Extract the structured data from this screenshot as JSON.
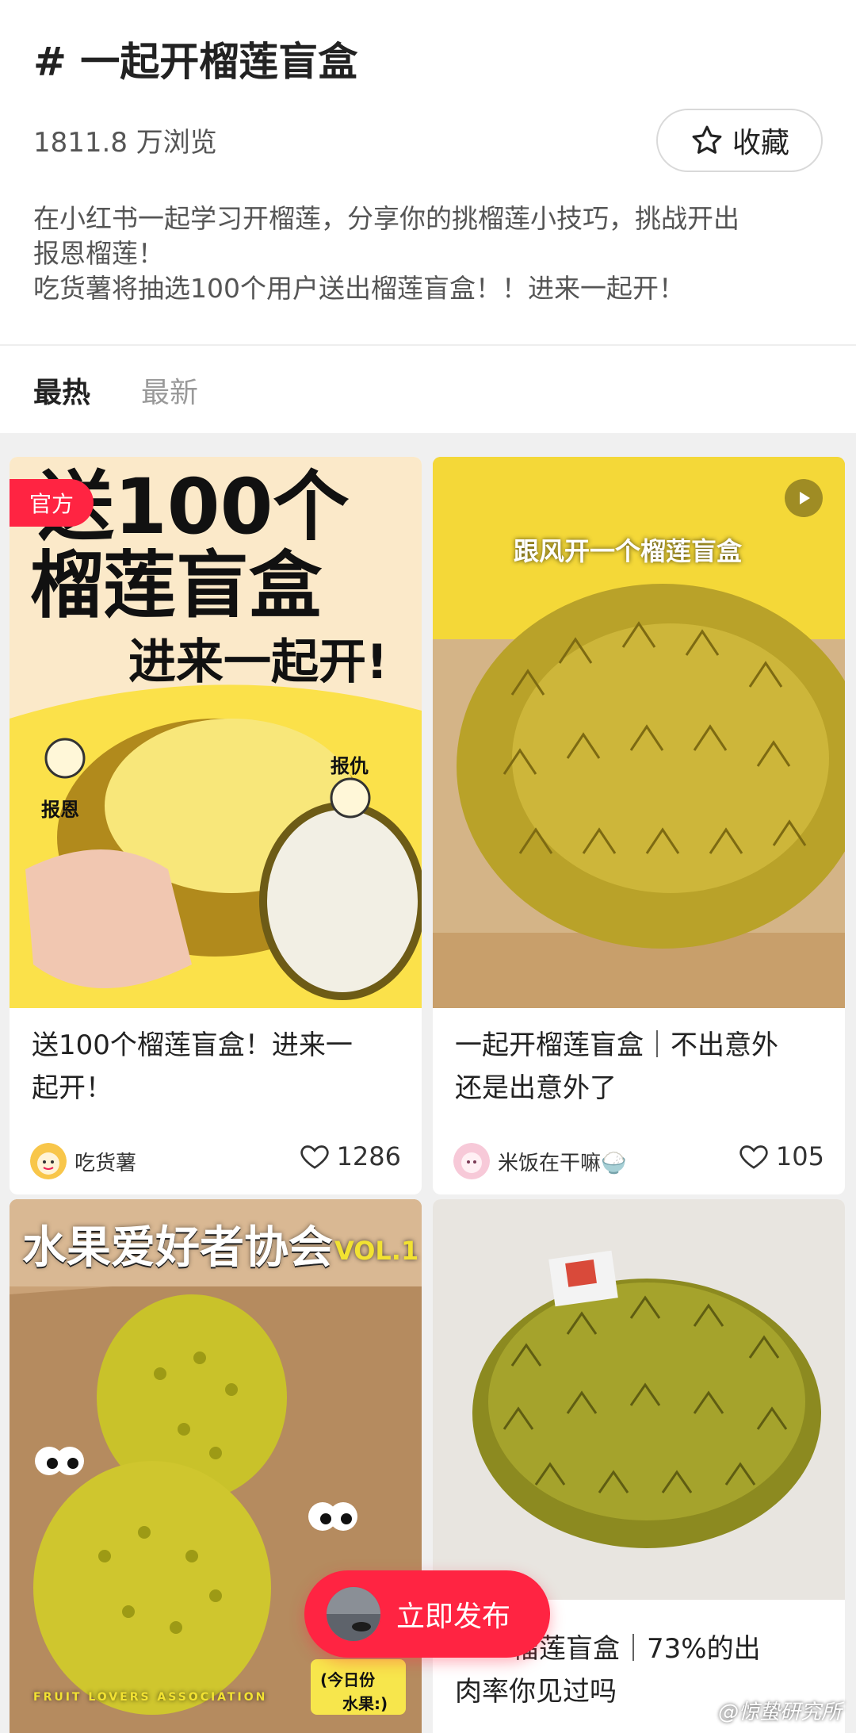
{
  "topic": {
    "title": "# 一起开榴莲盲盒",
    "views": "1811.8 万浏览",
    "favorite_label": "收藏",
    "description_lines": [
      "在小红书一起学习开榴莲，分享你的挑榴莲小技巧，挑战开出",
      "报恩榴莲！",
      "吃货薯将抽选100个用户送出榴莲盲盒！！进来一起开！"
    ]
  },
  "tabs": [
    {
      "label": "最热",
      "active": true
    },
    {
      "label": "最新",
      "active": false
    }
  ],
  "cards": [
    {
      "badge": "官方",
      "image_text": {
        "line1": "送100个",
        "line2": "榴莲盲盒",
        "line3": "进来一起开!",
        "tag_left": "报恩",
        "tag_right": "报仇"
      },
      "title_lines": [
        "送100个榴莲盲盒！进来一",
        "起开！"
      ],
      "author": "吃货薯",
      "likes": "1286"
    },
    {
      "image_text": {
        "caption": "跟风开一个榴莲盲盒"
      },
      "title_lines": [
        "一起开榴莲盲盒｜不出意外",
        "还是出意外了"
      ],
      "author": "米饭在干嘛🍚",
      "likes": "105"
    },
    {
      "image_text": {
        "heading": "水果爱好者协会",
        "vol": "VOL.1",
        "footer": "FRUIT LOVERS ASSOCIATION",
        "note1": "(今日份",
        "note2": "水果:)"
      }
    },
    {
      "title_lines": [
        "榴莲盲盒｜73%的出",
        "肉率你见过吗"
      ]
    }
  ],
  "fab": {
    "label": "立即发布"
  },
  "watermark": "@惊蛰研究所",
  "colors": {
    "accent": "#ff2442",
    "text": "#222222",
    "muted": "#999999"
  }
}
